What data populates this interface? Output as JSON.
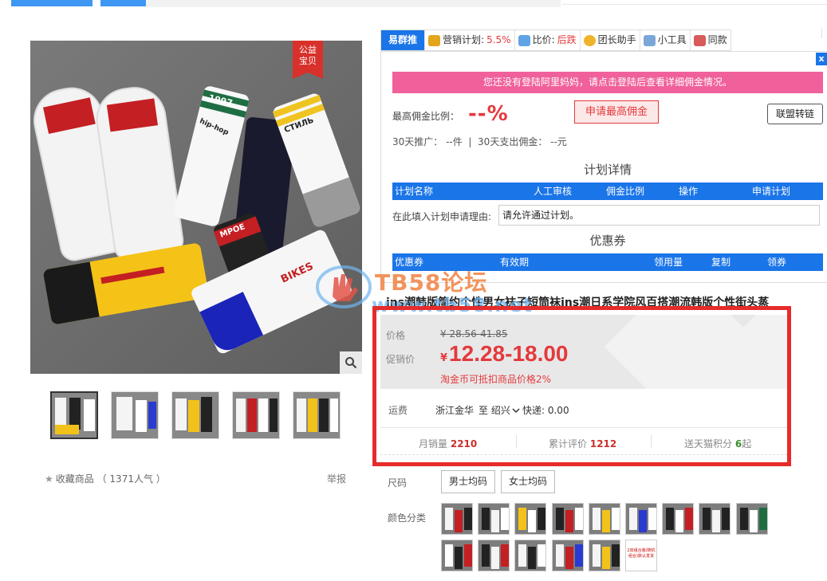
{
  "gallery": {
    "badge": "公益\n宝贝",
    "mark_top": "MPOE",
    "mark_1997": "1997",
    "mark_hiphop": "hip-hop",
    "mark_ctnab": "CTИЛЬ",
    "mark_bikes": "BIKES"
  },
  "favorite": {
    "label": "收藏商品",
    "popularity": "（ 1371人气 ）"
  },
  "report_label": "举报",
  "plugin": {
    "tabs": [
      {
        "label": "易群推",
        "active": true
      },
      {
        "label": "营销计划:",
        "value": "5.5%",
        "icon": "coins-icon"
      },
      {
        "label": "比价:",
        "value": "后跌",
        "icon": "cart-icon"
      },
      {
        "label": "团长助手",
        "icon": "leader-icon"
      },
      {
        "label": "小工具",
        "icon": "tools-icon"
      },
      {
        "label": "同款",
        "icon": "shop-icon"
      }
    ],
    "close_label": "x",
    "login_notice": "您还没有登陆阿里妈妈，请点击登陆后查看详细佣金情况。",
    "max_rate_label": "最高佣金比例：",
    "max_rate_value": "--%",
    "apply_button": "申请最高佣金",
    "alliance_button": "联盟转链",
    "stats_30d": "30天推广： --件  |  30天支出佣金： --元",
    "plan_title": "计划详情",
    "plan_headers": [
      "计划名称",
      "人工审核",
      "佣金比例",
      "操作",
      "申请计划"
    ],
    "reason_label": "在此填入计划申请理由:",
    "reason_value": "请允许通过计划。",
    "coupon_title": "优惠券",
    "coupon_headers": [
      "优惠券",
      "有效期",
      "领用量",
      "复制",
      "领券"
    ]
  },
  "product": {
    "title": "ins潮韩版简约个性男女袜子短筒袜ins潮日系学院风百搭潮流韩版个性街头蒸"
  },
  "watermark": {
    "text": "TB58论坛",
    "url": "www.tb58.net"
  },
  "price": {
    "label": "价格",
    "original": "¥ 28.56-41.85",
    "promo_label": "促销价",
    "currency": "¥",
    "promo_value": "12.28-18.00",
    "taojin_note": "淘金币可抵扣商品价格2%"
  },
  "shipping": {
    "label": "运费",
    "from": "浙江金华",
    "to": "至 绍兴",
    "fee": "快递: 0.00"
  },
  "stats": {
    "monthly_sales_label": "月销量",
    "monthly_sales": "2210",
    "reviews_label": "累计评价",
    "reviews": "1212",
    "points_label": "送天猫积分",
    "points": "6",
    "points_suffix": "起"
  },
  "sku": {
    "size_label": "尺码",
    "sizes": [
      "男士均码",
      "女士均码"
    ],
    "color_label": "颜色分类",
    "last_swatch_text": "2双组合装(随机组合)默认发货"
  },
  "colors": {
    "accent_blue": "#1a75e8",
    "price_red": "#e4393c",
    "login_pink": "#f0609b",
    "frame_red": "#e62b2b"
  }
}
